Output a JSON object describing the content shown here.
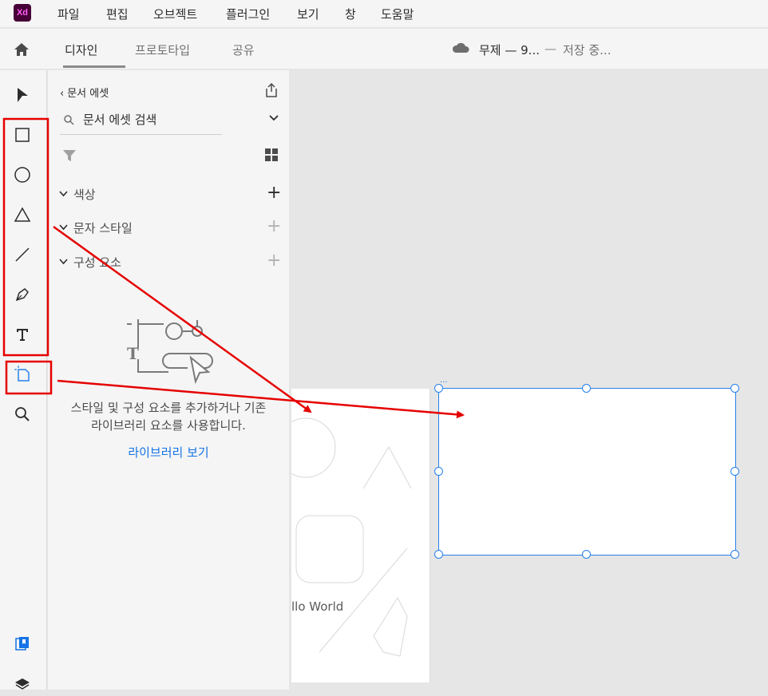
{
  "app": {
    "logo_text": "Xd",
    "accent": "#ff61f6",
    "logo_bg": "#470137"
  },
  "menu": [
    "파일",
    "편집",
    "오브젝트",
    "플러그인",
    "보기",
    "창",
    "도움말"
  ],
  "tabs": {
    "design": "디자인",
    "prototype": "프로토타입",
    "share": "공유"
  },
  "document": {
    "title": "무제 — 9...",
    "separator": "—",
    "status": "저장 중..."
  },
  "toolbar_tools": [
    "select-icon",
    "rectangle-icon",
    "ellipse-icon",
    "polygon-icon",
    "line-icon",
    "pen-icon",
    "text-icon",
    "artboard-icon",
    "zoom-icon"
  ],
  "panel": {
    "header": "문서 에셋",
    "search_placeholder": "문서 에셋 검색",
    "sections": {
      "colors": "색상",
      "character_styles": "문자 스타일",
      "components": "구성 요소"
    },
    "empty_message_line1": "스타일 및 구성 요소를 추가하거나 기존",
    "empty_message_line2": "라이브러리 요소를 사용합니다.",
    "library_link": "라이브러리 보기"
  },
  "canvas": {
    "artboard_text": "llo World",
    "artboard_label": "..."
  },
  "annotation_color": "#e60000",
  "selection_color": "#2680eb"
}
